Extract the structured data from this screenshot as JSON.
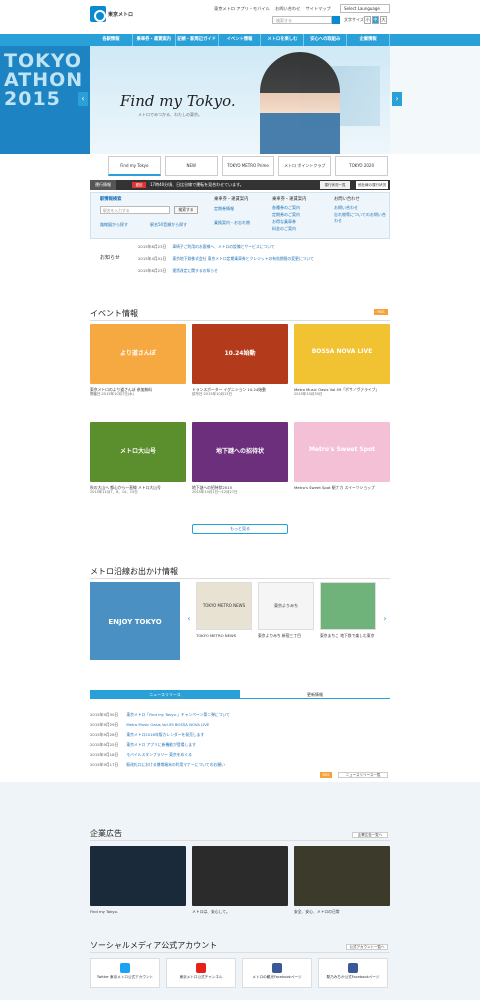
{
  "header": {
    "brand": "東京メトロ",
    "top_links": [
      "東京メトロ アプリ・モバイル",
      "お問い合わせ",
      "サイトマップ"
    ],
    "language": "Select Launguage",
    "search_placeholder": "検索する",
    "font_size_label": "文字サイズ",
    "font_sizes": [
      "小",
      "中",
      "大"
    ]
  },
  "nav": [
    "各駅情報",
    "乗車券・運賃案内",
    "記帳・駅周辺ガイド",
    "イベント情報",
    "メトロを楽しむ",
    "安心への取組み",
    "企業情報"
  ],
  "hero": {
    "side_text": "TOKYO ATHON 2015",
    "title": "Find my Tokyo.",
    "subtitle": "メトロでみつかる、わたしの東京。"
  },
  "banners": [
    "Find my Tokyo",
    "NEW",
    "TOKYO METRO Prime",
    "メトロ ポイントクラブ",
    "TOKYO 2020"
  ],
  "status": {
    "label": "運行情報",
    "badge": "遅延",
    "text": "17時40分頃、日比谷線で運転を見合わせています。",
    "btn1": "運行状況一覧",
    "btn2": "他社線の運行状況"
  },
  "panel": {
    "station_search": "駅情報検索",
    "station_placeholder": "駅名を入力する",
    "search_btn": "検索する",
    "station_link1": "路線図から探す",
    "station_link2": "駅名50音順から探す",
    "route_search": "乗車券・運賃案内",
    "route_links": [
      "定期券情報",
      "乗換案内・お忘れ物",
      "運賃検索",
      "各種検索"
    ],
    "fare": "乗車券・運賃案内",
    "fare_links": [
      "各種券のご案内",
      "定期券のご案内",
      "お得な乗車券",
      "料金のご案内"
    ],
    "contact": "お問い合わせ",
    "contact_links": [
      "お問い合わせ",
      "忘れ物等についてのお問い合わせ"
    ]
  },
  "news": {
    "heading": "お知らせ",
    "items": [
      {
        "date": "2015年6月23日",
        "text": "車椅子ご利用のお客様へ、メトロの設備とサービスについて"
      },
      {
        "date": "2015年4月01日",
        "text": "東京地下鉄株式会社 東京メトロ定期乗車券とクレジットの有効期限の変更について"
      },
      {
        "date": "2015年6月23日",
        "text": "運賃改定に関するお知らせ"
      }
    ]
  },
  "events": {
    "heading": "イベント情報",
    "rss": "RSS",
    "cards": [
      {
        "text": "東京メトロのより道さんぽ 参加無料",
        "date": "開催日:2015年10月7日(水)",
        "color": "#f7a941",
        "label": "より道さんぽ"
      },
      {
        "text": "トランスポーター イグニション 10.24始動",
        "date": "試写日:2015年10月13日",
        "color": "#b33a1a",
        "label": "10.24始動"
      },
      {
        "text": "Metro Music Oasis Vol.59「ボサノヴァライブ」",
        "date": "2015年10月30日",
        "color": "#f1c232",
        "label": "BOSSA NOVA LIVE"
      },
      {
        "text": "秋の大山へ 都心から一直線 メトロ大山号",
        "date": "2015年11月7、8、14、15日",
        "color": "#5b8f2d",
        "label": "メトロ大山号"
      },
      {
        "text": "地下謎への招待状2015",
        "date": "2015年10月1日〜12月27日",
        "color": "#6b2f7b",
        "label": "地下謎への招待状"
      },
      {
        "text": "Metro's Sweet Spot 駅ナカ スイーツショップ",
        "date": "",
        "color": "#f4c0d5",
        "label": "Metro's Sweet Spot"
      }
    ],
    "more": "もっと見る"
  },
  "routes": {
    "heading": "メトロ沿線お出かけ情報",
    "cards": [
      {
        "text": "",
        "color": "#4a90c2",
        "label": "ENJOY TOKYO"
      },
      {
        "text": "TOKYO METRO NEWS",
        "color": "#e8e2d2",
        "label": "TOKYO METRO NEWS"
      },
      {
        "text": "東京よりみち 新宿三丁目",
        "color": "#f5f5f5",
        "label": "東京よりみち"
      },
      {
        "text": "東京まちこ 地下鉄で楽しむ東京",
        "color": "#6fb27a",
        "label": ""
      }
    ]
  },
  "tabs": {
    "tab1": "ニュースリリース",
    "tab2": "更新情報"
  },
  "releases": [
    {
      "date": "2015年9月30日",
      "text": "東京メトロ「Find my Tokyo.」キャンペーン第二弾について"
    },
    {
      "date": "2015年9月29日",
      "text": "Metro Music Oasis Vol.59 BOSSA NOVA LIVE"
    },
    {
      "date": "2015年9月28日",
      "text": "東京メトロ2016年版カレンダーを発売します"
    },
    {
      "date": "2015年9月25日",
      "text": "東京メトロ アプリに新機能が登場します"
    },
    {
      "date": "2015年9月18日",
      "text": "モバイルスタンプラリー 東京をめぐる"
    },
    {
      "date": "2015年9月17日",
      "text": "駅改札口における携帯端末の利用マナーについてのお願い"
    }
  ],
  "release_btn": "ニュースリリース一覧",
  "ads": {
    "heading": "企業広告",
    "btn": "企業広告一覧へ",
    "cards": [
      {
        "text": "Find my Tokyo.",
        "color": "#1a2a3a"
      },
      {
        "text": "メトロは、安心して。",
        "color": "#2b2b2b"
      },
      {
        "text": "安全、安心、メトロの日常",
        "color": "#3c3a2a"
      }
    ]
  },
  "social": {
    "heading": "ソーシャルメディア公式アカウント",
    "btn": "公式アカウント一覧へ",
    "items": [
      "Twitter 東京メトロ公式アカウント",
      "東京メトロ公式チャンネル",
      "メトロの観光Facebookページ",
      "駅乃みちか公式Facebookページ"
    ]
  }
}
